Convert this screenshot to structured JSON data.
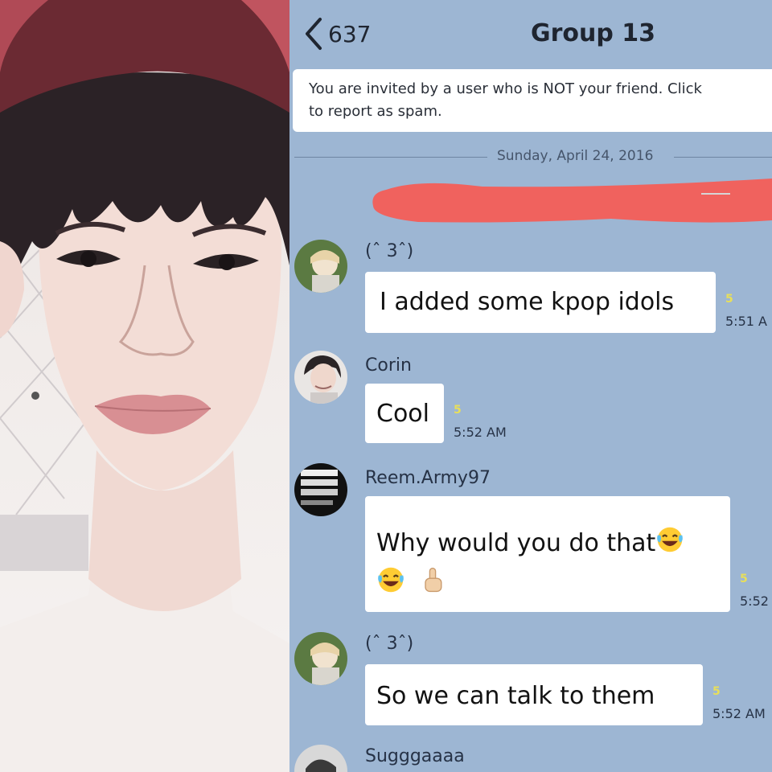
{
  "photo": {
    "alt": "portrait photo"
  },
  "header": {
    "back_count": "637",
    "title": "Group 13"
  },
  "invite": {
    "line1": "You are invited by a user who is NOT your friend. Click",
    "line2": "to report as spam."
  },
  "date_separator": "Sunday, April 24, 2016",
  "messages": [
    {
      "sender": "(ˆ 3ˆ)",
      "text": "I added some kpop idols",
      "read": "5",
      "time": "5:51 A"
    },
    {
      "sender": "Corin",
      "text": "Cool",
      "read": "5",
      "time": "5:52 AM"
    },
    {
      "sender": "Reem.Army97",
      "text_line1": "Why would you do that",
      "read": "5",
      "time": "5:52"
    },
    {
      "sender": "(ˆ 3ˆ)",
      "text": "So we can talk to them",
      "read": "5",
      "time": "5:52 AM"
    },
    {
      "sender": "Sugggaaaa"
    }
  ],
  "colors": {
    "chat_background": "#9db6d3",
    "read_count": "#e8df5a",
    "redaction": "#f0625e"
  },
  "icons": [
    "chevron-left-icon",
    "laughing-tears-emoji",
    "pointing-finger-emoji"
  ]
}
